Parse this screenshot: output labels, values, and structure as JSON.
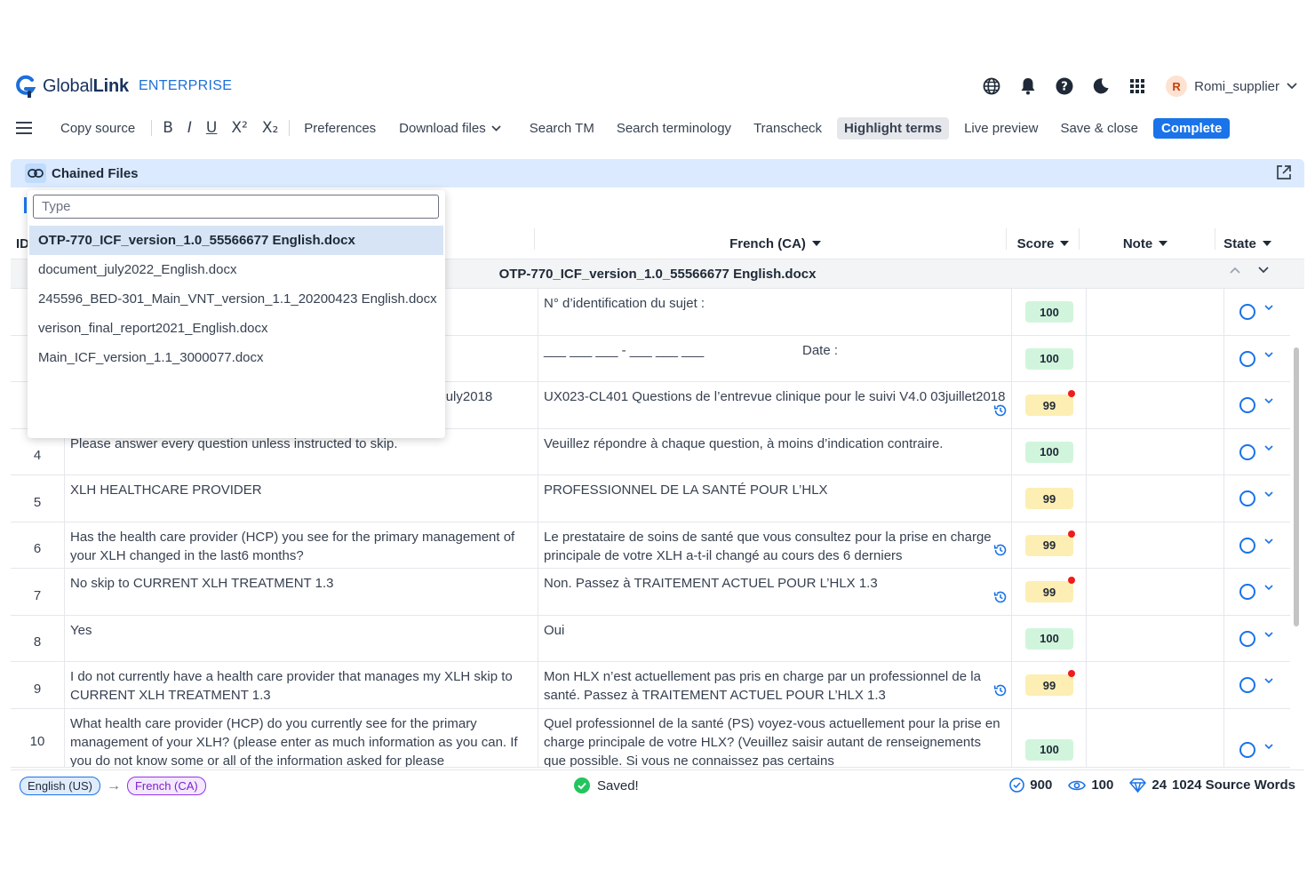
{
  "header": {
    "logo_global": "Global",
    "logo_link": "Link",
    "logo_sub": "ENTERPRISE",
    "user_initial": "R",
    "user_name": "Romi_supplier"
  },
  "toolbar": {
    "copy_source": "Copy source",
    "bold": "B",
    "italic": "I",
    "underline": "U",
    "superscript": "X²",
    "subscript": "X₂",
    "preferences": "Preferences",
    "download_files": "Download files",
    "search_tm": "Search TM",
    "search_terminology": "Search terminology",
    "transcheck": "Transcheck",
    "highlight_terms": "Highlight terms",
    "live_preview": "Live preview",
    "save_close": "Save & close",
    "complete": "Complete"
  },
  "banner": {
    "title": "Chained Files"
  },
  "dropdown": {
    "placeholder": "Type",
    "items": [
      "OTP-770_ICF_version_1.0_55566677 English.docx",
      "document_july2022_English.docx",
      "245596_BED-301_Main_VNT_version_1.1_20200423 English.docx",
      "verison_final_report2021_English.docx",
      "Main_ICF_version_1.1_3000077.docx"
    ]
  },
  "columns": {
    "id": "ID",
    "target": "French (CA)",
    "score": "Score",
    "note": "Note",
    "state": "State"
  },
  "file_group": "OTP-770_ICF_version_1.0_55566677 English.docx",
  "rows": [
    {
      "id": "1",
      "source": "",
      "target": "N° d’identification du sujet :",
      "score": "100"
    },
    {
      "id": "2",
      "source": "",
      "target": "___ ___ ___ - ___ ___ ___",
      "target_date": "Date :",
      "score": "100"
    },
    {
      "id": "3",
      "source": "UX023-CL401 Follow-Up Clinical Interview Questions V4.0 03.July2018",
      "target": "UX023-CL401 Questions de l’entrevue clinique pour le suivi V4.0 03juillet2018",
      "score": "99"
    },
    {
      "id": "4",
      "source": "Please answer every question unless instructed to skip.",
      "target": "Veuillez répondre à chaque question, à moins d’indication contraire.",
      "score": "100"
    },
    {
      "id": "5",
      "source": "XLH HEALTHCARE PROVIDER",
      "target": "PROFESSIONNEL DE LA SANTÉ POUR L’HLX",
      "score": "99"
    },
    {
      "id": "6",
      "source": "Has the health care provider (HCP) you see for the primary management of your XLH changed in the last6 months?",
      "target": "Le prestataire de soins de santé que vous consultez pour la prise en charge principale de votre XLH a-t-il changé au cours des 6 derniers",
      "score": "99"
    },
    {
      "id": "7",
      "source": "No  skip to CURRENT XLH TREATMENT 1.3",
      "target": "Non.  Passez à TRAITEMENT ACTUEL POUR L’HLX 1.3",
      "score": "99"
    },
    {
      "id": "8",
      "source": "Yes",
      "target": "Oui",
      "score": "100"
    },
    {
      "id": "9",
      "source": "I do not currently have a health care provider that manages my XLH skip to CURRENT XLH TREATMENT 1.3",
      "target": "Mon HLX n’est actuellement pas pris en charge par un professionnel de la santé.  Passez à TRAITEMENT ACTUEL POUR L’HLX 1.3",
      "score": "99"
    },
    {
      "id": "10",
      "source": "What health care provider (HCP) do you currently see for the primary management of your XLH? (please enter as much information as you can. If you do not know some or all of the information asked for please",
      "target": "Quel professionnel de la santé (PS) voyez-vous actuellement pour la prise en charge principale de votre HLX? (Veuillez saisir autant de renseignements que possible. Si vous ne connaissez pas certains",
      "score": "100"
    }
  ],
  "footer": {
    "source_lang": "English (US)",
    "target_lang": "French (CA)",
    "saved": "Saved!",
    "confirmed": "900",
    "viewed": "100",
    "gems": "24",
    "source_words": "1024 Source Words"
  },
  "colors": {
    "accent": "#1a73e8",
    "banner_bg": "#dbeafe",
    "score_100": "#d1f5dc",
    "score_99": "#fdeeb3",
    "error_dot": "#ef1c1c",
    "saved_green": "#22c55e"
  }
}
